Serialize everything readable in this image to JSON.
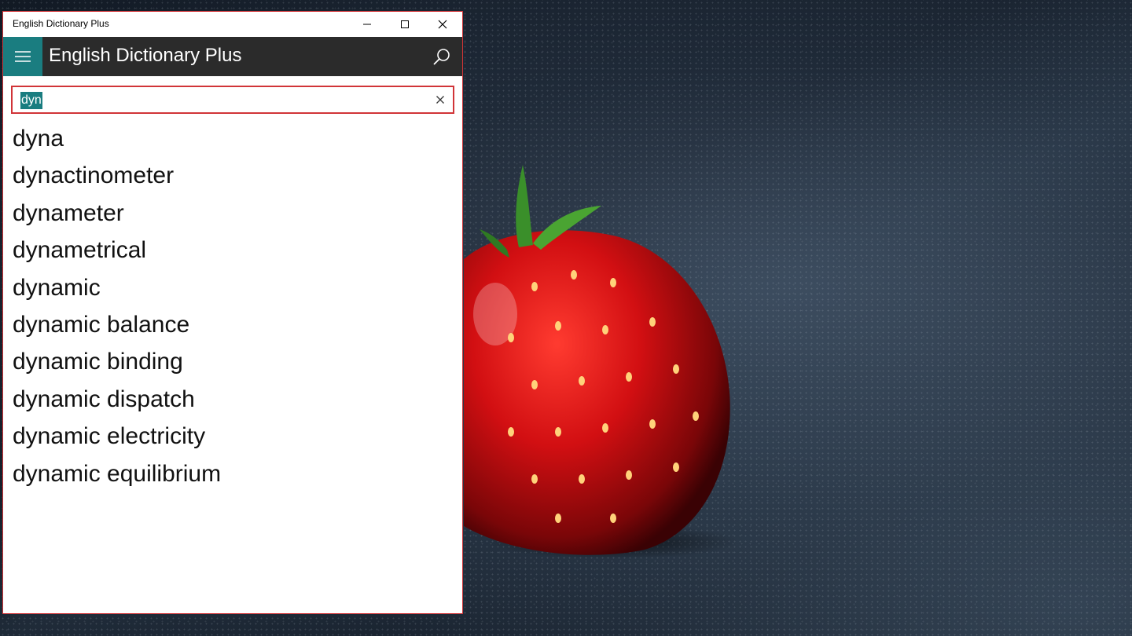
{
  "window": {
    "title": "English Dictionary Plus",
    "controls": {
      "minimize_icon": "minimize-icon",
      "maximize_icon": "maximize-icon",
      "close_icon": "close-icon"
    }
  },
  "appbar": {
    "title": "English Dictionary Plus",
    "menu_icon": "hamburger-icon",
    "search_icon": "search-icon",
    "accent_color": "#1a7d80",
    "background_color": "#2b2b2b"
  },
  "search": {
    "value": "dyn",
    "clear_icon": "clear-icon",
    "border_color": "#d13438"
  },
  "results": [
    "dyna",
    "dynactinometer",
    "dynameter",
    "dynametrical",
    "dynamic",
    "dynamic balance",
    "dynamic binding",
    "dynamic dispatch",
    "dynamic electricity",
    "dynamic equilibrium"
  ],
  "wallpaper": {
    "subject": "strawberry"
  }
}
